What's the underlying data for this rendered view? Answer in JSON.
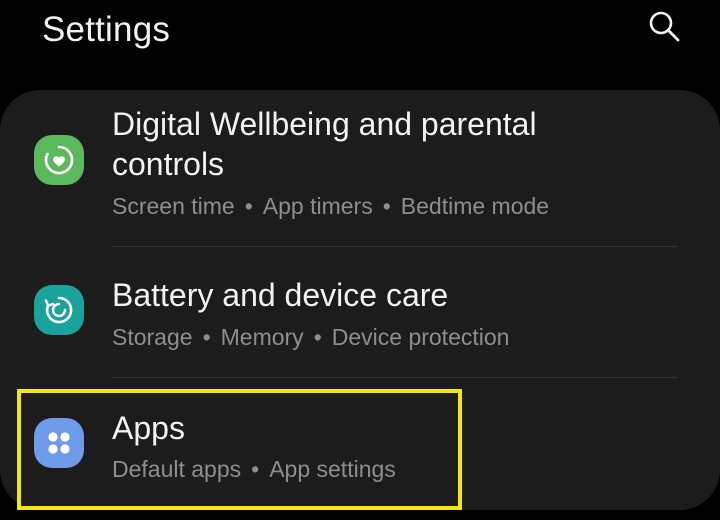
{
  "header": {
    "title": "Settings"
  },
  "icons": {
    "search": "search-icon",
    "digital_wellbeing": "digital-wellbeing-icon",
    "battery": "device-care-icon",
    "apps": "apps-grid-icon"
  },
  "colors": {
    "background": "#000000",
    "card": "#1c1c1c",
    "wellbeing_icon": "#5cb85c",
    "battery_icon": "#1aa39a",
    "apps_icon": "#6f9bea",
    "highlight": "#f5e60f",
    "subtitle": "#8e8e8e"
  },
  "items": [
    {
      "title_line1": "Digital Wellbeing and parental",
      "title_line2": "controls",
      "subtitles": [
        "Screen time",
        "App timers",
        "Bedtime mode"
      ],
      "separator": "•"
    },
    {
      "title": "Battery and device care",
      "subtitles": [
        "Storage",
        "Memory",
        "Device protection"
      ],
      "separator": "•"
    },
    {
      "title": "Apps",
      "subtitles": [
        "Default apps",
        "App settings"
      ],
      "separator": "•",
      "highlighted": true
    }
  ]
}
